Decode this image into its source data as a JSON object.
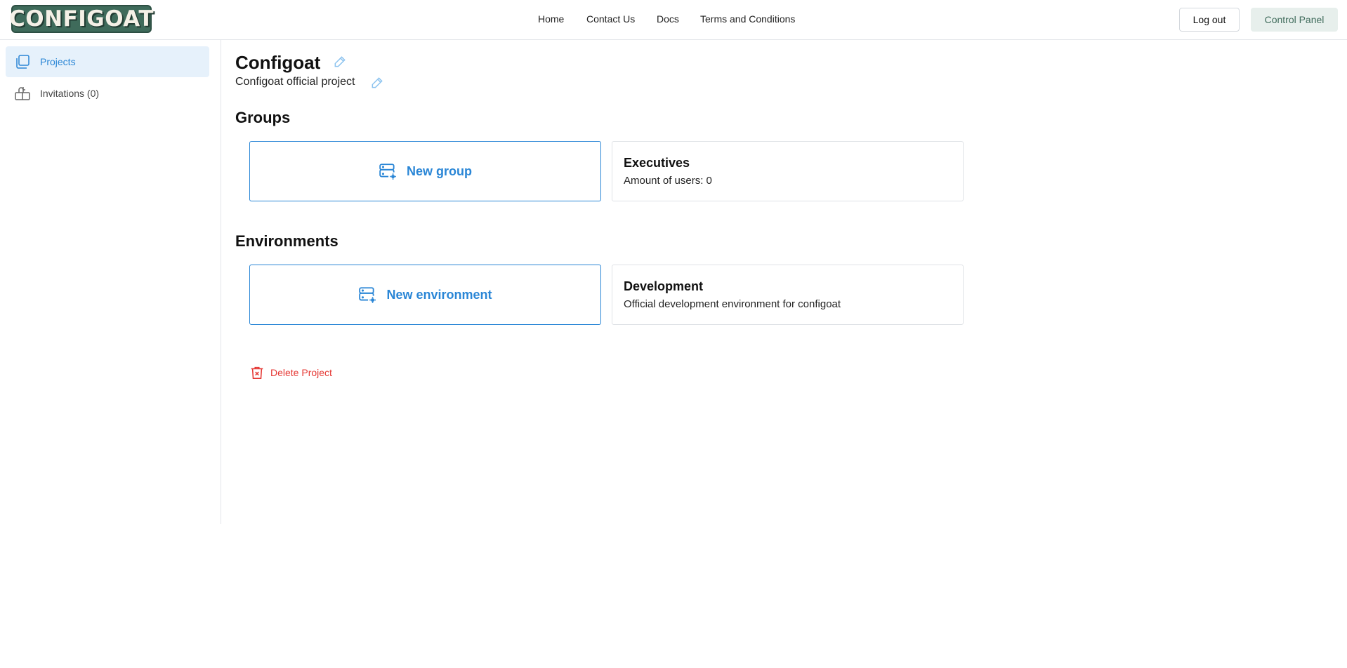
{
  "header": {
    "logo_text": "CONFIGOAT",
    "nav": [
      {
        "label": "Home"
      },
      {
        "label": "Contact Us"
      },
      {
        "label": "Docs"
      },
      {
        "label": "Terms and Conditions"
      }
    ],
    "logout_label": "Log out",
    "control_panel_label": "Control Panel"
  },
  "sidebar": {
    "items": [
      {
        "label": "Projects",
        "icon": "projects-icon",
        "active": true
      },
      {
        "label": "Invitations (0)",
        "icon": "mailbox-icon",
        "active": false
      }
    ]
  },
  "project": {
    "title": "Configoat",
    "description": "Configoat official project"
  },
  "groups": {
    "heading": "Groups",
    "new_label": "New group",
    "items": [
      {
        "name": "Executives",
        "detail": "Amount of users: 0"
      }
    ]
  },
  "environments": {
    "heading": "Environments",
    "new_label": "New environment",
    "items": [
      {
        "name": "Development",
        "detail": "Official development environment for configoat"
      }
    ]
  },
  "actions": {
    "delete_label": "Delete Project"
  },
  "colors": {
    "accent": "#2a86d6",
    "brand": "#3f6b5b",
    "danger": "#e53935",
    "active_bg": "#e6f1fb"
  }
}
